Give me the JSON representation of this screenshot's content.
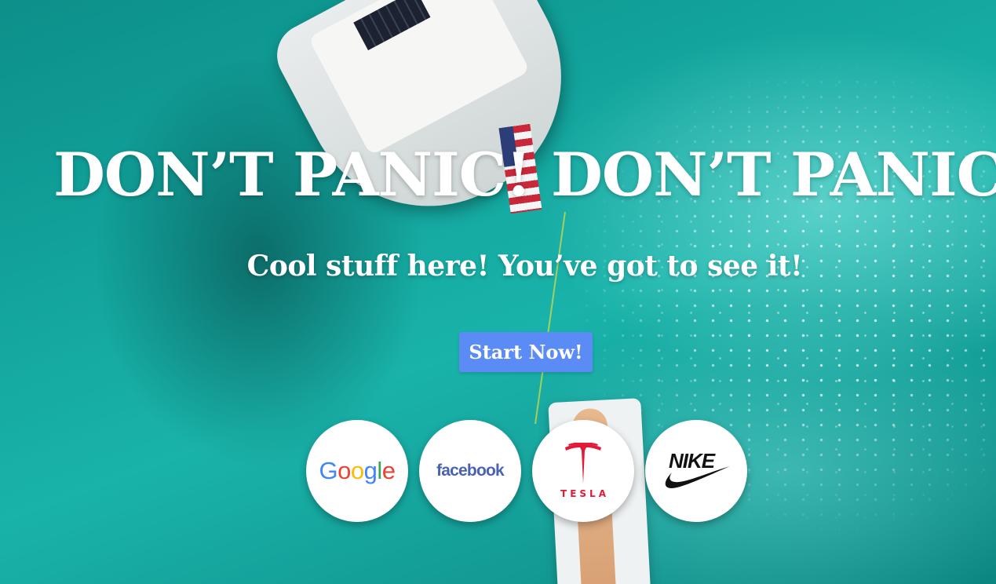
{
  "hero": {
    "title": "DON’T PANIC! DON’T PANIC!",
    "subtitle": "Cool stuff here! You’ve got to see it!",
    "cta_label": "Start Now!"
  },
  "logos": [
    {
      "name": "Google",
      "icon": "google-logo-icon"
    },
    {
      "name": "facebook",
      "icon": "facebook-logo-icon"
    },
    {
      "name": "TESLA",
      "icon": "tesla-logo-icon"
    },
    {
      "name": "NIKE",
      "icon": "nike-logo-icon"
    }
  ],
  "colors": {
    "cta_background": "#5b8cf6",
    "text": "#ffffff",
    "water": "#14a59e",
    "tesla_red": "#e31937",
    "facebook_blue": "#4b62b3"
  }
}
